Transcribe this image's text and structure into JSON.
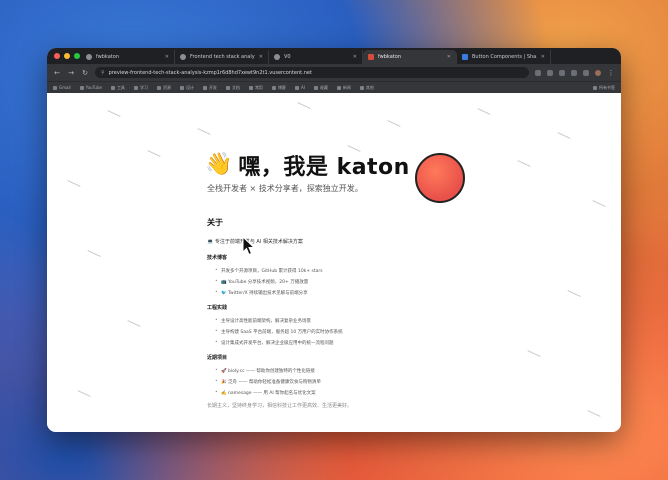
{
  "browser": {
    "tabs": [
      {
        "label": "fwbkaton",
        "icon": "globe-icon"
      },
      {
        "label": "Frontend tech stack analysi",
        "icon": "globe-icon"
      },
      {
        "label": "V0",
        "icon": "globe-icon"
      },
      {
        "label": "fwbkaton",
        "icon": "katon-icon",
        "active": true
      },
      {
        "label": "Button Components | Sha.cn",
        "icon": "globe-icon"
      }
    ],
    "url": "preview-frontend-tech-stack-analysis-kzmp1r6d8hd7xewt9n2t1.vusercontent.net",
    "bookmarks": [
      "Gmail",
      "YouTube",
      "工具",
      "学习",
      "资源",
      "设计",
      "开发",
      "文档",
      "常用",
      "博客",
      "AI",
      "收藏",
      "新闻",
      "其他",
      "所有书签"
    ],
    "colors": {
      "close": "#ff5f57",
      "minimize": "#febc2e",
      "maximize": "#28c840"
    }
  },
  "page": {
    "hero_emoji": "👋",
    "title": "嘿，我是 katon",
    "subtitle": "全栈开发者 × 技术分享者，探索独立开发。",
    "about": {
      "heading": "关于",
      "intro": "💻 专注于前端开发与 AI 相关技术解决方案"
    },
    "groups": [
      {
        "heading": "技术博客",
        "items": [
          "开发多个开源项目，GitHub 累计获得 10k+ stars",
          "📺 YouTube 分享技术视频，20+ 万播放量",
          "🐦 Twitter/X 持续输出技术见解与前端分享"
        ]
      },
      {
        "heading": "工程实践",
        "items": [
          "主导设计高性能前端架构，解决复杂业务场景",
          "主导构建 SaaS 平台前端，服务超 10 万用户的实时协作系统",
          "设计集成式开发平台，解决企业级应用中的统一流程问题"
        ]
      },
      {
        "heading": "近期项目",
        "items": [
          "🚀 bioly.cc —— 帮助你创建独特的个性化链接",
          "🎉 泛舟 —— 帮助你轻松准备健康饮食与购物清单",
          "✍️ namesage —— 用 AI 帮你起名与优化文案"
        ]
      }
    ],
    "footer": "长期主义，坚持终身学习，相信科技让工作更高效、生活更美好。"
  }
}
